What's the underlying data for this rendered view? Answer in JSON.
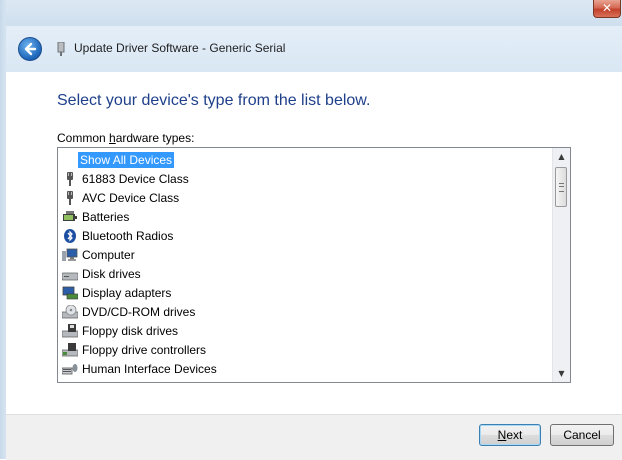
{
  "window": {
    "title": "Update Driver Software - Generic Serial",
    "close_glyph": "✕"
  },
  "main": {
    "heading": "Select your device's type from the list below.",
    "list_label_prefix": "Common ",
    "list_label_accel": "h",
    "list_label_rest": "ardware types:",
    "items": [
      {
        "label": "Show All Devices",
        "icon": "none",
        "selected": true
      },
      {
        "label": "61883 Device Class",
        "icon": "plug-icon"
      },
      {
        "label": "AVC Device Class",
        "icon": "plug-icon"
      },
      {
        "label": "Batteries",
        "icon": "battery-icon"
      },
      {
        "label": "Bluetooth Radios",
        "icon": "bluetooth-icon"
      },
      {
        "label": "Computer",
        "icon": "computer-icon"
      },
      {
        "label": "Disk drives",
        "icon": "disk-drive-icon"
      },
      {
        "label": "Display adapters",
        "icon": "display-adapter-icon"
      },
      {
        "label": "DVD/CD-ROM drives",
        "icon": "dvd-drive-icon"
      },
      {
        "label": "Floppy disk drives",
        "icon": "floppy-drive-icon"
      },
      {
        "label": "Floppy drive controllers",
        "icon": "floppy-controller-icon"
      },
      {
        "label": "Human Interface Devices",
        "icon": "hid-icon"
      }
    ]
  },
  "footer": {
    "next_accel": "N",
    "next_rest": "ext",
    "cancel_label": "Cancel"
  },
  "colors": {
    "heading": "#1e3f8a",
    "selection": "#3399ff"
  }
}
